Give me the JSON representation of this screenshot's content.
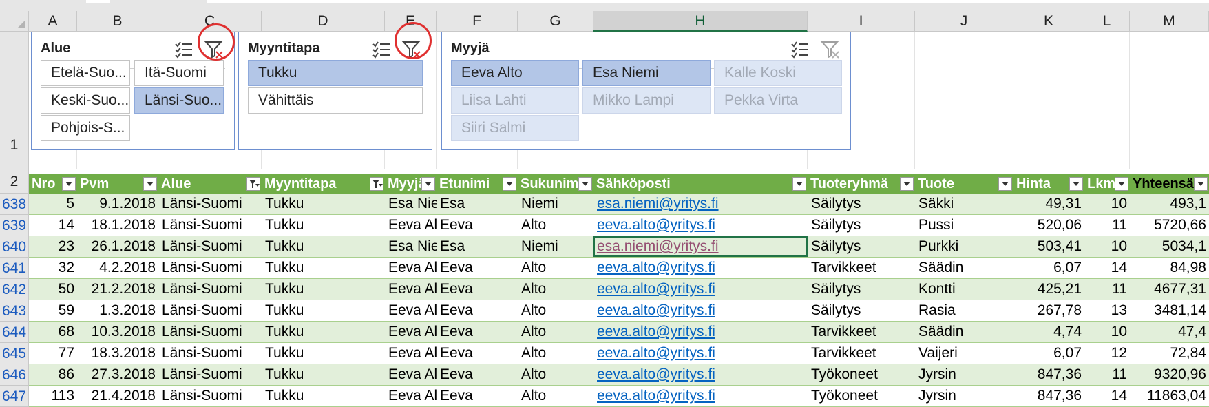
{
  "columns": [
    "A",
    "B",
    "C",
    "D",
    "E",
    "F",
    "G",
    "H",
    "I",
    "J",
    "K",
    "L",
    "M"
  ],
  "selected_column": "H",
  "row_labels": {
    "slicer_row": "1",
    "header_row": "2"
  },
  "slicers": [
    {
      "title": "Alue",
      "items": [
        {
          "label": "Etelä-Suo...",
          "state": "normal"
        },
        {
          "label": "Itä-Suomi",
          "state": "normal"
        },
        {
          "label": "Keski-Suo...",
          "state": "normal"
        },
        {
          "label": "Länsi-Suo...",
          "state": "selected"
        },
        {
          "label": "Pohjois-S...",
          "state": "normal"
        }
      ]
    },
    {
      "title": "Myyntitapa",
      "items": [
        {
          "label": "Tukku",
          "state": "selected"
        },
        {
          "label": "Vähittäis",
          "state": "normal"
        }
      ]
    },
    {
      "title": "Myyjä",
      "items": [
        {
          "label": "Eeva Alto",
          "state": "selected"
        },
        {
          "label": "Esa Niemi",
          "state": "selected"
        },
        {
          "label": "Kalle Koski",
          "state": "dim"
        },
        {
          "label": "Liisa Lahti",
          "state": "dim"
        },
        {
          "label": "Mikko Lampi",
          "state": "dim"
        },
        {
          "label": "Pekka Virta",
          "state": "dim"
        },
        {
          "label": "Siiri Salmi",
          "state": "dim"
        }
      ]
    }
  ],
  "icons": {
    "multi_select": "multi-select-icon",
    "clear_filter": "clear-filter-icon"
  },
  "colors": {
    "header_green": "#70ad47",
    "band_green": "#e2efda",
    "slicer_selected": "#b3c6e7",
    "highlight_circle": "#e03030",
    "link": "#0563c1"
  },
  "table": {
    "headers": [
      {
        "label": "Nro",
        "filtered": false
      },
      {
        "label": "Pvm",
        "filtered": false
      },
      {
        "label": "Alue",
        "filtered": true
      },
      {
        "label": "Myyntitapa",
        "filtered": true
      },
      {
        "label": "Myyjä",
        "filtered": false
      },
      {
        "label": "Etunimi",
        "filtered": false
      },
      {
        "label": "Sukunimi",
        "filtered": false
      },
      {
        "label": "Sähköposti",
        "filtered": false
      },
      {
        "label": "Tuoteryhmä",
        "filtered": false
      },
      {
        "label": "Tuote",
        "filtered": false
      },
      {
        "label": "Hinta",
        "filtered": false
      },
      {
        "label": "Lkm",
        "filtered": false
      },
      {
        "label": "Yhteensä",
        "filtered": false
      }
    ],
    "rows": [
      {
        "row": "638",
        "cells": [
          "5",
          "9.1.2018",
          "Länsi-Suomi",
          "Tukku",
          "Esa Niemi",
          "Esa",
          "Niemi",
          "esa.niemi@yritys.fi",
          "Säilytys",
          "Säkki",
          "49,31",
          "10",
          "493,1"
        ]
      },
      {
        "row": "639",
        "cells": [
          "14",
          "18.1.2018",
          "Länsi-Suomi",
          "Tukku",
          "Eeva Alto",
          "Eeva",
          "Alto",
          "eeva.alto@yritys.fi",
          "Säilytys",
          "Pussi",
          "520,06",
          "11",
          "5720,66"
        ]
      },
      {
        "row": "640",
        "cells": [
          "23",
          "26.1.2018",
          "Länsi-Suomi",
          "Tukku",
          "Esa Niemi",
          "Esa",
          "Niemi",
          "esa.niemi@yritys.fi",
          "Säilytys",
          "Purkki",
          "503,41",
          "10",
          "5034,1"
        ]
      },
      {
        "row": "641",
        "cells": [
          "32",
          "4.2.2018",
          "Länsi-Suomi",
          "Tukku",
          "Eeva Alto",
          "Eeva",
          "Alto",
          "eeva.alto@yritys.fi",
          "Tarvikkeet",
          "Säädin",
          "6,07",
          "14",
          "84,98"
        ]
      },
      {
        "row": "642",
        "cells": [
          "50",
          "21.2.2018",
          "Länsi-Suomi",
          "Tukku",
          "Eeva Alto",
          "Eeva",
          "Alto",
          "eeva.alto@yritys.fi",
          "Säilytys",
          "Kontti",
          "425,21",
          "11",
          "4677,31"
        ]
      },
      {
        "row": "643",
        "cells": [
          "59",
          "1.3.2018",
          "Länsi-Suomi",
          "Tukku",
          "Eeva Alto",
          "Eeva",
          "Alto",
          "eeva.alto@yritys.fi",
          "Säilytys",
          "Rasia",
          "267,78",
          "13",
          "3481,14"
        ]
      },
      {
        "row": "644",
        "cells": [
          "68",
          "10.3.2018",
          "Länsi-Suomi",
          "Tukku",
          "Eeva Alto",
          "Eeva",
          "Alto",
          "eeva.alto@yritys.fi",
          "Tarvikkeet",
          "Säädin",
          "4,74",
          "10",
          "47,4"
        ]
      },
      {
        "row": "645",
        "cells": [
          "77",
          "18.3.2018",
          "Länsi-Suomi",
          "Tukku",
          "Eeva Alto",
          "Eeva",
          "Alto",
          "eeva.alto@yritys.fi",
          "Tarvikkeet",
          "Vaijeri",
          "6,07",
          "12",
          "72,84"
        ]
      },
      {
        "row": "646",
        "cells": [
          "86",
          "27.3.2018",
          "Länsi-Suomi",
          "Tukku",
          "Eeva Alto",
          "Eeva",
          "Alto",
          "eeva.alto@yritys.fi",
          "Työkoneet",
          "Jyrsin",
          "847,36",
          "11",
          "9320,96"
        ]
      },
      {
        "row": "647",
        "cells": [
          "113",
          "21.4.2018",
          "Länsi-Suomi",
          "Tukku",
          "Eeva Alto",
          "Eeva",
          "Alto",
          "eeva.alto@yritys.fi",
          "Työkoneet",
          "Jyrsin",
          "847,36",
          "14",
          "11863,04"
        ]
      }
    ]
  }
}
